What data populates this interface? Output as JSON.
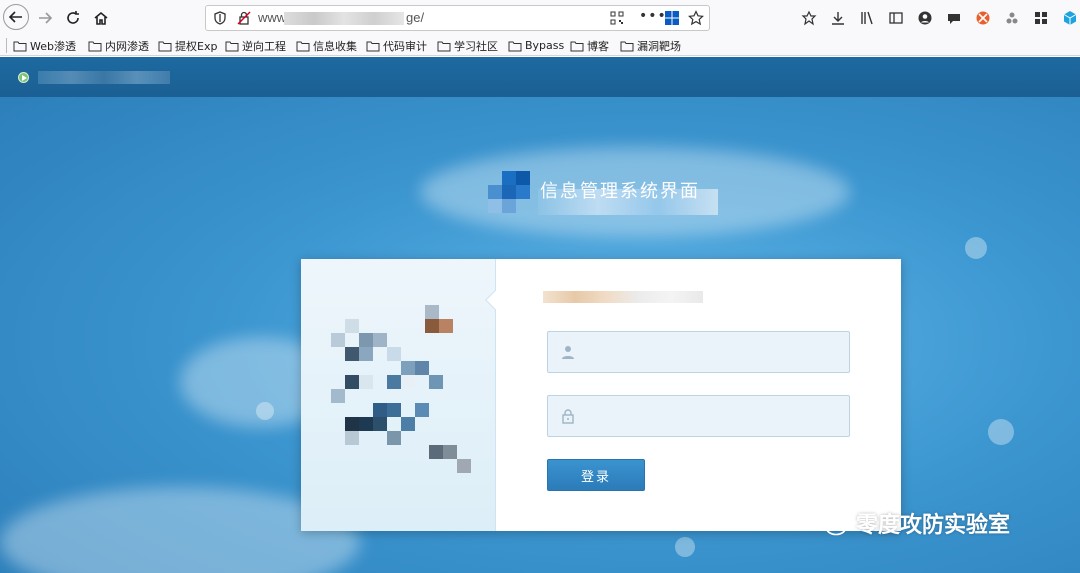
{
  "browser": {
    "url_prefix": "www",
    "url_suffix": "ge/",
    "more_label": "•••",
    "bookmarks": [
      {
        "label": "Web渗透"
      },
      {
        "label": "内网渗透"
      },
      {
        "label": "提权Exp"
      },
      {
        "label": "逆向工程"
      },
      {
        "label": "信息收集"
      },
      {
        "label": "代码审计"
      },
      {
        "label": "学习社区"
      },
      {
        "label": "Bypass"
      },
      {
        "label": "博客"
      },
      {
        "label": "漏洞靶场"
      }
    ],
    "toolbar_icons": [
      "reader-view-icon",
      "download-icon",
      "library-icon",
      "sidebar-icon",
      "account-icon",
      "chat-icon",
      "blocked-extension-icon",
      "extension-icon",
      "grid-extension-icon",
      "cube-extension-icon"
    ]
  },
  "page": {
    "system_title": "信息管理系统界面",
    "login": {
      "username_placeholder": "",
      "password_placeholder": "",
      "submit_label": "登录"
    },
    "watermark": "零度攻防实验室"
  },
  "colors": {
    "accent": "#2b7cb9",
    "page_bg": "#3c96d0",
    "header_bg": "#1b5f93"
  }
}
